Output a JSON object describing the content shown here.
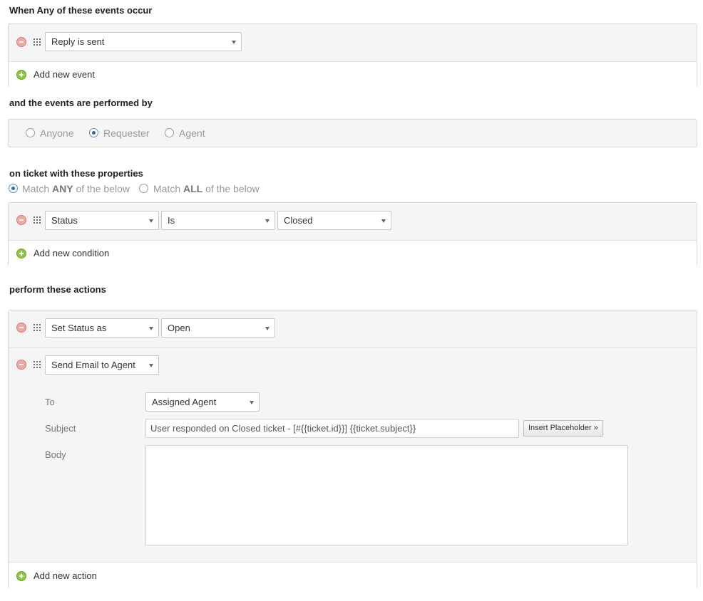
{
  "events": {
    "heading": "When Any of these events occur",
    "items": [
      {
        "value": "Reply is sent"
      }
    ],
    "add_label": "Add new event"
  },
  "performer": {
    "heading": "and the events are performed by",
    "options": [
      "Anyone",
      "Requester",
      "Agent"
    ],
    "selected": "Requester"
  },
  "conditions": {
    "heading": "on ticket with these properties",
    "match_any_prefix": "Match ",
    "match_any_keyword": "ANY",
    "match_any_suffix": " of the below",
    "match_all_prefix": "Match ",
    "match_all_keyword": "ALL",
    "match_all_suffix": " of the below",
    "selected_match": "ANY",
    "items": [
      {
        "field": "Status",
        "operator": "Is",
        "value": "Closed"
      }
    ],
    "add_label": "Add new condition"
  },
  "actions": {
    "heading": "perform these actions",
    "items": [
      {
        "action": "Set Status as",
        "value": "Open"
      },
      {
        "action": "Send Email to Agent",
        "to_label": "To",
        "to_value": "Assigned Agent",
        "subject_label": "Subject",
        "subject_value": "User responded on Closed ticket - [#{{ticket.id}}] {{ticket.subject}}",
        "insert_placeholder_label": "Insert Placeholder »",
        "body_label": "Body",
        "body_value": ""
      }
    ],
    "add_label": "Add new action"
  },
  "colors": {
    "remove": "#f0a9a2",
    "add": "#8dc63f",
    "radio_selected": "#2a6ab0",
    "panel_bg": "#f5f5f5"
  }
}
